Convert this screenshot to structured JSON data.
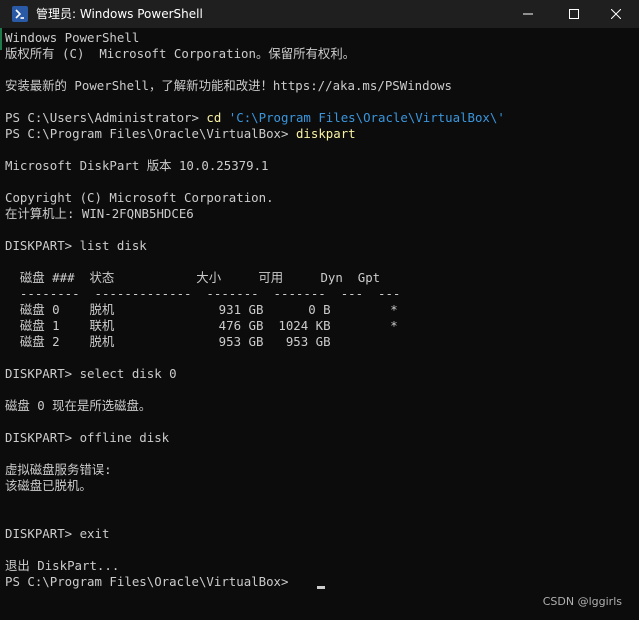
{
  "window": {
    "title": "管理员: Windows PowerShell"
  },
  "console": {
    "lines": [
      {
        "text": "Windows PowerShell"
      },
      {
        "text": "版权所有 (C)  Microsoft Corporation。保留所有权利。"
      },
      {
        "text": ""
      },
      {
        "text": "安装最新的 PowerShell，了解新功能和改进！https://aka.ms/PSWindows"
      },
      {
        "text": ""
      },
      {
        "prompt": "PS C:\\Users\\Administrator> ",
        "cmd": "cd",
        "arg": " 'C:\\Program Files\\Oracle\\VirtualBox\\'"
      },
      {
        "prompt": "PS C:\\Program Files\\Oracle\\VirtualBox> ",
        "cmd": "diskpart"
      },
      {
        "text": ""
      },
      {
        "text": "Microsoft DiskPart 版本 10.0.25379.1"
      },
      {
        "text": ""
      },
      {
        "text": "Copyright (C) Microsoft Corporation."
      },
      {
        "text": "在计算机上: WIN-2FQNB5HDCE6"
      },
      {
        "text": ""
      },
      {
        "text": "DISKPART> list disk"
      },
      {
        "text": ""
      },
      {
        "text": "  磁盘 ###  状态           大小     可用     Dyn  Gpt"
      },
      {
        "text": "  --------  -------------  -------  -------  ---  ---"
      },
      {
        "text": "  磁盘 0    脱机              931 GB      0 B        *"
      },
      {
        "text": "  磁盘 1    联机              476 GB  1024 KB        *"
      },
      {
        "text": "  磁盘 2    脱机              953 GB   953 GB"
      },
      {
        "text": ""
      },
      {
        "text": "DISKPART> select disk 0"
      },
      {
        "text": ""
      },
      {
        "text": "磁盘 0 现在是所选磁盘。"
      },
      {
        "text": ""
      },
      {
        "text": "DISKPART> offline disk"
      },
      {
        "text": ""
      },
      {
        "text": "虚拟磁盘服务错误:"
      },
      {
        "text": "该磁盘已脱机。"
      },
      {
        "text": ""
      },
      {
        "text": ""
      },
      {
        "text": "DISKPART> exit"
      },
      {
        "text": ""
      },
      {
        "text": "退出 DiskPart..."
      },
      {
        "prompt": "PS C:\\Program Files\\Oracle\\VirtualBox> "
      }
    ]
  },
  "watermark": "CSDN @lggirls",
  "icons": {
    "app": "powershell-icon",
    "minimize": "minimize-icon",
    "maximize": "maximize-icon",
    "close": "close-icon"
  },
  "colors": {
    "background": "#0c0c0c",
    "foreground": "#cccccc",
    "command": "#f9f1a5",
    "path_string": "#3a96dd",
    "titlebar": "#1f1f1f"
  }
}
